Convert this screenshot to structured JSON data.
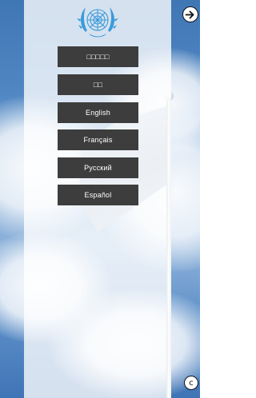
{
  "logo": {
    "icon": "un-emblem-icon",
    "color": "#3a9ad9"
  },
  "languages": [
    {
      "label": "□□□□□"
    },
    {
      "label": "□□"
    },
    {
      "label": "English"
    },
    {
      "label": "Français"
    },
    {
      "label": "Русский"
    },
    {
      "label": "Español"
    }
  ],
  "controls": {
    "next_icon": "arrow-right-circle-icon",
    "copyright_label": "c"
  },
  "colors": {
    "button_bg": "#3d3d3d",
    "button_text": "#ffffff",
    "panel": "rgba(255,255,255,0.78)"
  }
}
